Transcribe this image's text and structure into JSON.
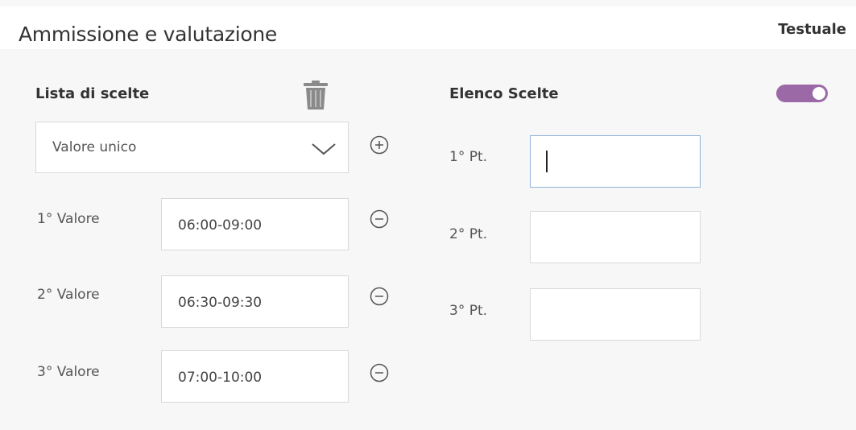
{
  "header": {
    "title": "Ammissione e valutazione",
    "mode_label": "Testuale"
  },
  "left": {
    "section_label": "Lista di scelte",
    "select": {
      "value": "Valore unico"
    },
    "rows": [
      {
        "label": "1° Valore",
        "value": "06:00-09:00"
      },
      {
        "label": "2° Valore",
        "value": "06:30-09:30"
      },
      {
        "label": "3° Valore",
        "value": "07:00-10:00"
      }
    ]
  },
  "right": {
    "section_label": "Elenco Scelte",
    "toggle": {
      "on": true,
      "color": "#9b6aa6"
    },
    "points": [
      {
        "label": "1° Pt.",
        "value": ""
      },
      {
        "label": "2° Pt.",
        "value": ""
      },
      {
        "label": "3° Pt.",
        "value": ""
      }
    ]
  },
  "icons": [
    "trash-icon",
    "chevron-down-icon",
    "plus-circle-icon",
    "minus-circle-icon",
    "toggle-switch"
  ]
}
